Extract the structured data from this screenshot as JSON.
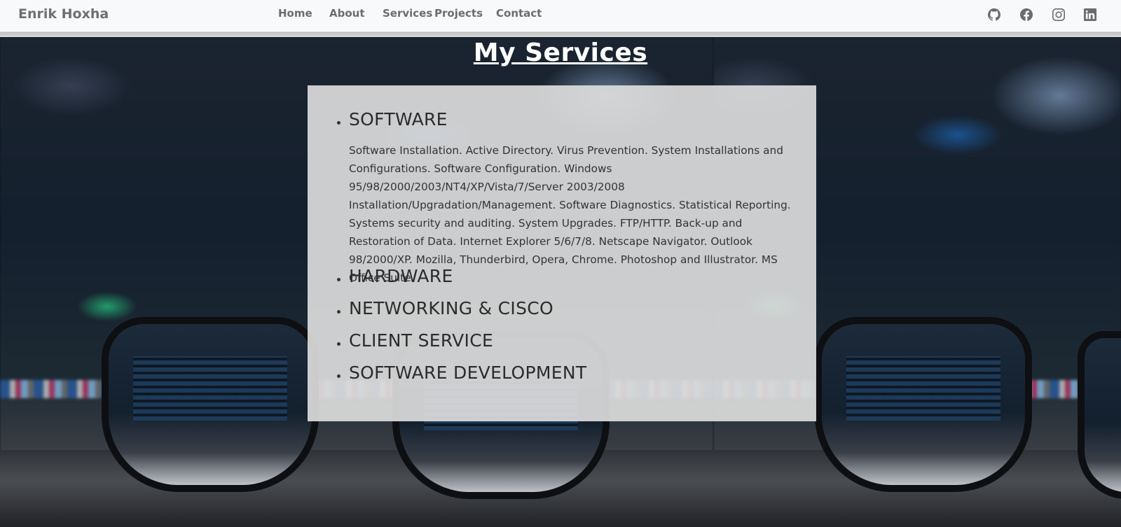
{
  "navbar": {
    "brand": "Enrik Hoxha",
    "links": [
      {
        "label": "Home"
      },
      {
        "label": "About"
      },
      {
        "label": "Services"
      },
      {
        "label": "Projects"
      },
      {
        "label": "Contact"
      }
    ],
    "social_icons": [
      "github-icon",
      "facebook-icon",
      "instagram-icon",
      "linkedin-icon"
    ],
    "color": "#6c6c6c",
    "background": "#f8f9fa"
  },
  "page": {
    "title": "My Services"
  },
  "services": [
    {
      "title": "SOFTWARE",
      "description": "Software Installation. Active Directory. Virus Prevention. System Installations and Configurations. Software Configuration. Windows 95/98/2000/2003/NT4/XP/Vista/7/Server 2003/2008 Installation/Upgradation/Management. Software Diagnostics. Statistical Reporting. Systems security and auditing. System Upgrades. FTP/HTTP. Back-up and Restoration of Data. Internet Explorer 5/6/7/8. Netscape Navigator. Outlook 98/2000/XP. Mozilla, Thunderbird, Opera, Chrome. Photoshop and Illustrator. MS Office Suite."
    },
    {
      "title": "HARDWARE"
    },
    {
      "title": "NETWORKING & CISCO"
    },
    {
      "title": "CLIENT SERVICE"
    },
    {
      "title": "SOFTWARE DEVELOPMENT"
    }
  ],
  "colors": {
    "card_background": "#dcdcdc",
    "title_color": "#ffffff",
    "text_color": "#333333"
  }
}
